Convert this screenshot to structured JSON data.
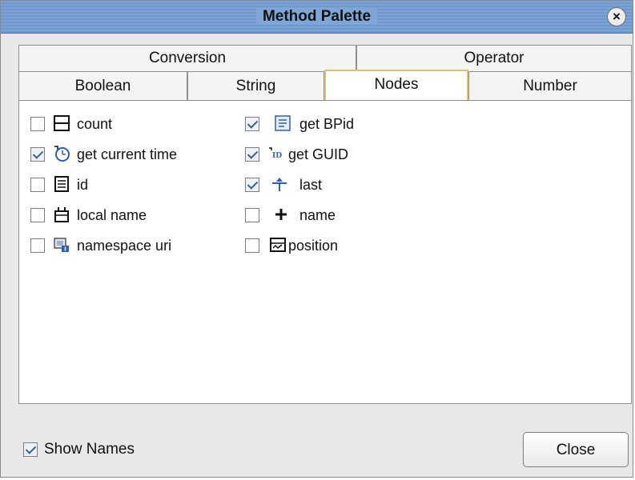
{
  "window": {
    "title": "Method Palette"
  },
  "tabs": {
    "row1": [
      {
        "label": "Conversion"
      },
      {
        "label": "Operator"
      }
    ],
    "row2": [
      {
        "label": "Boolean"
      },
      {
        "label": "String"
      },
      {
        "label": "Nodes",
        "selected": true
      },
      {
        "label": "Number"
      }
    ]
  },
  "methods": [
    {
      "label": "count",
      "checked": false,
      "icon": "count-icon"
    },
    {
      "label": "get current time",
      "checked": true,
      "icon": "clock-icon"
    },
    {
      "label": "id",
      "checked": false,
      "icon": "id-icon"
    },
    {
      "label": "local name",
      "checked": false,
      "icon": "local-name-icon"
    },
    {
      "label": "namespace uri",
      "checked": false,
      "icon": "namespace-uri-icon"
    },
    {
      "label": "get BPid",
      "checked": true,
      "icon": "bpid-icon"
    },
    {
      "label": "get GUID",
      "checked": true,
      "icon": "guid-icon"
    },
    {
      "label": "last",
      "checked": true,
      "icon": "last-icon"
    },
    {
      "label": "name",
      "checked": false,
      "icon": "plus-icon"
    },
    {
      "label": "position",
      "checked": false,
      "icon": "position-icon"
    }
  ],
  "footer": {
    "show_names_label": "Show Names",
    "show_names_checked": true,
    "close_label": "Close"
  }
}
